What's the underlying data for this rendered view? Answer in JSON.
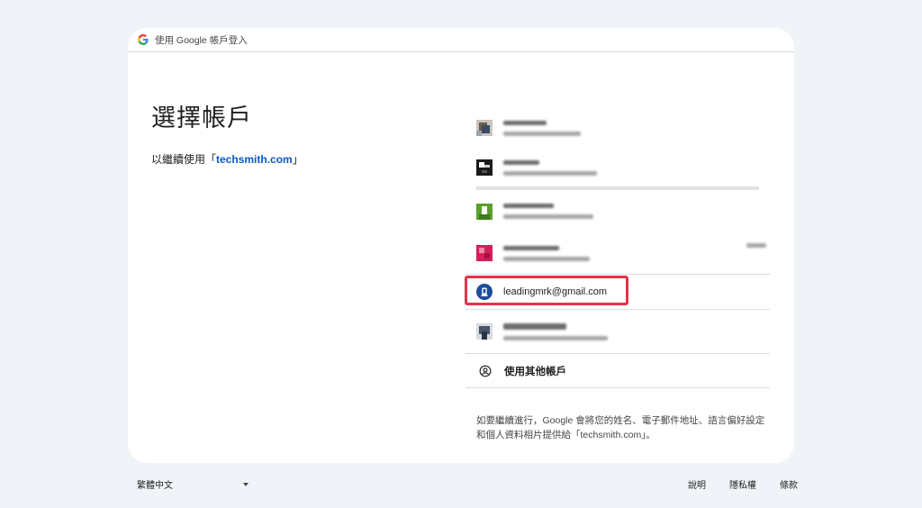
{
  "header": {
    "title": "使用 Google 帳戶登入"
  },
  "main": {
    "title": "選擇帳戶",
    "subtitle_prefix": "以繼續使用「",
    "subtitle_link": "techsmith.com",
    "subtitle_suffix": "」"
  },
  "accounts": {
    "highlighted_email": "leadingmrk@gmail.com",
    "use_other_label": "使用其他帳戶"
  },
  "notice": "如要繼續進行，Google 會將您的姓名、電子郵件地址、語言偏好設定和個人資料相片提供給「techsmith.com」。",
  "footer": {
    "language": "繁體中文",
    "help": "說明",
    "privacy": "隱私權",
    "terms": "條款"
  },
  "colors": {
    "background": "#f0f4f9",
    "link": "#0b57d0",
    "highlight": "#e5334a"
  }
}
